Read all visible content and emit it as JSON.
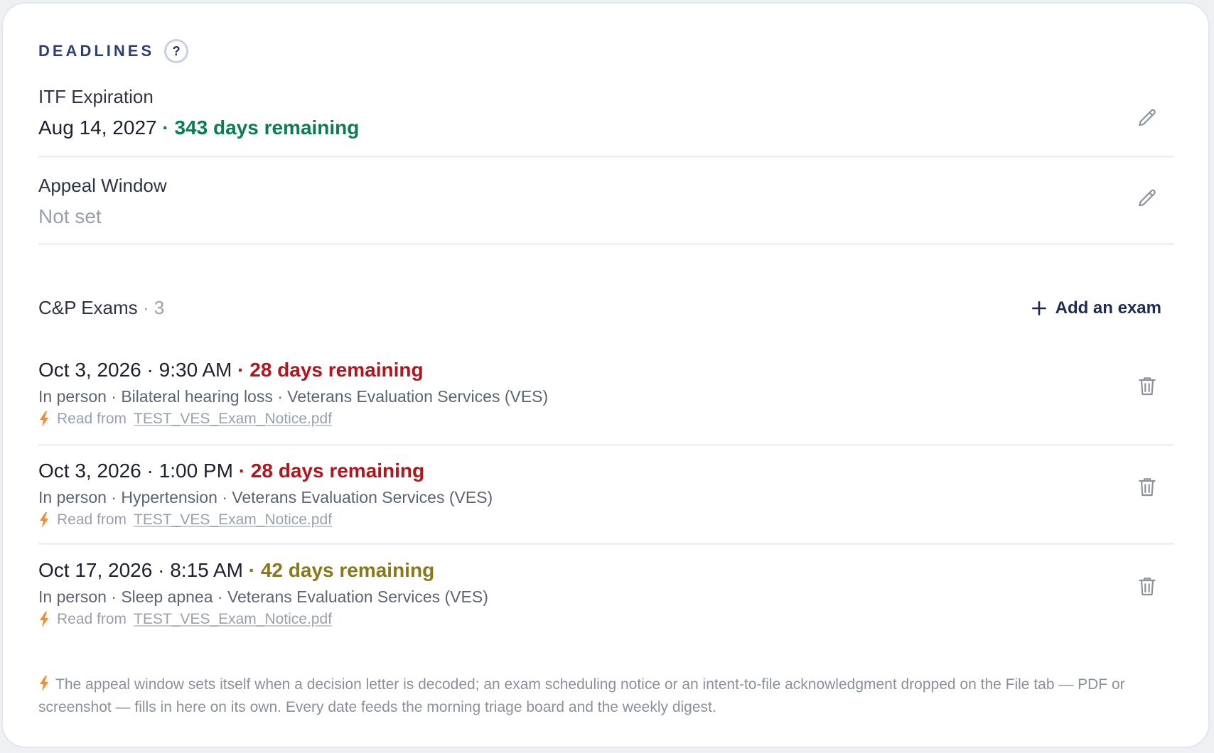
{
  "header": {
    "title": "DEADLINES",
    "help_label": "?"
  },
  "itf": {
    "label": "ITF Expiration",
    "date": "Aug 14, 2027",
    "remaining": "· 343 days remaining"
  },
  "appeal": {
    "label": "Appeal Window",
    "value": "Not set"
  },
  "exams": {
    "title": "C&P Exams",
    "count": "· 3",
    "add_label": "Add an exam",
    "items": [
      {
        "when": "Oct 3, 2026 · 9:30 AM",
        "remaining": "· 28 days remaining",
        "details": "In person · Bilateral hearing loss · Veterans Evaluation Services (VES)",
        "source_prefix": "Read from",
        "source_file": "TEST_VES_Exam_Notice.pdf"
      },
      {
        "when": "Oct 3, 2026 · 1:00 PM",
        "remaining": "· 28 days remaining",
        "details": "In person · Hypertension · Veterans Evaluation Services (VES)",
        "source_prefix": "Read from",
        "source_file": "TEST_VES_Exam_Notice.pdf"
      },
      {
        "when": "Oct 17, 2026 · 8:15 AM",
        "remaining": "· 42 days remaining",
        "details": "In person · Sleep apnea · Veterans Evaluation Services (VES)",
        "source_prefix": "Read from",
        "source_file": "TEST_VES_Exam_Notice.pdf"
      }
    ]
  },
  "footnote": "The appeal window sets itself when a decision letter is decoded; an exam scheduling notice or an intent-to-file acknowledgment dropped on the File tab — PDF or screenshot — fills in here on its own. Every date feeds the morning triage board and the weekly digest.",
  "colors": {
    "accent_navy": "#2f3f72",
    "ok_green": "#0c7d4e",
    "urgent_red": "#b5141b",
    "warn_olive": "#8a7716",
    "bolt_orange": "#f08a3c"
  },
  "icons": {
    "edit": "pencil-icon",
    "delete": "trash-icon",
    "add": "plus-icon",
    "source": "bolt-icon"
  }
}
